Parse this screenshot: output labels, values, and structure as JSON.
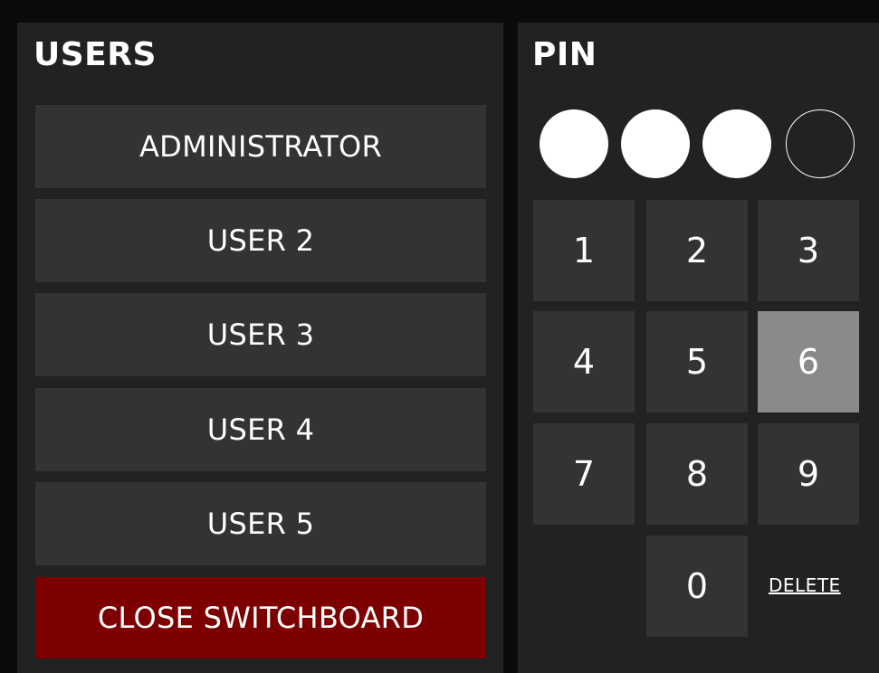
{
  "users_panel": {
    "title": "USERS",
    "users": [
      "ADMINISTRATOR",
      "USER 2",
      "USER 3",
      "USER 4",
      "USER 5"
    ],
    "close_label": "CLOSE SWITCHBOARD"
  },
  "pin_panel": {
    "title": "PIN",
    "pin_length": 4,
    "pin_entered": 3,
    "keys": [
      "1",
      "2",
      "3",
      "4",
      "5",
      "6",
      "7",
      "8",
      "9",
      "0"
    ],
    "pressed_key": "6",
    "delete_label": "DELETE"
  },
  "colors": {
    "background": "#0b0b0b",
    "panel": "#222222",
    "button": "#333333",
    "button_pressed": "#8a8a8a",
    "close_button": "#7d0000",
    "text": "#ffffff"
  }
}
